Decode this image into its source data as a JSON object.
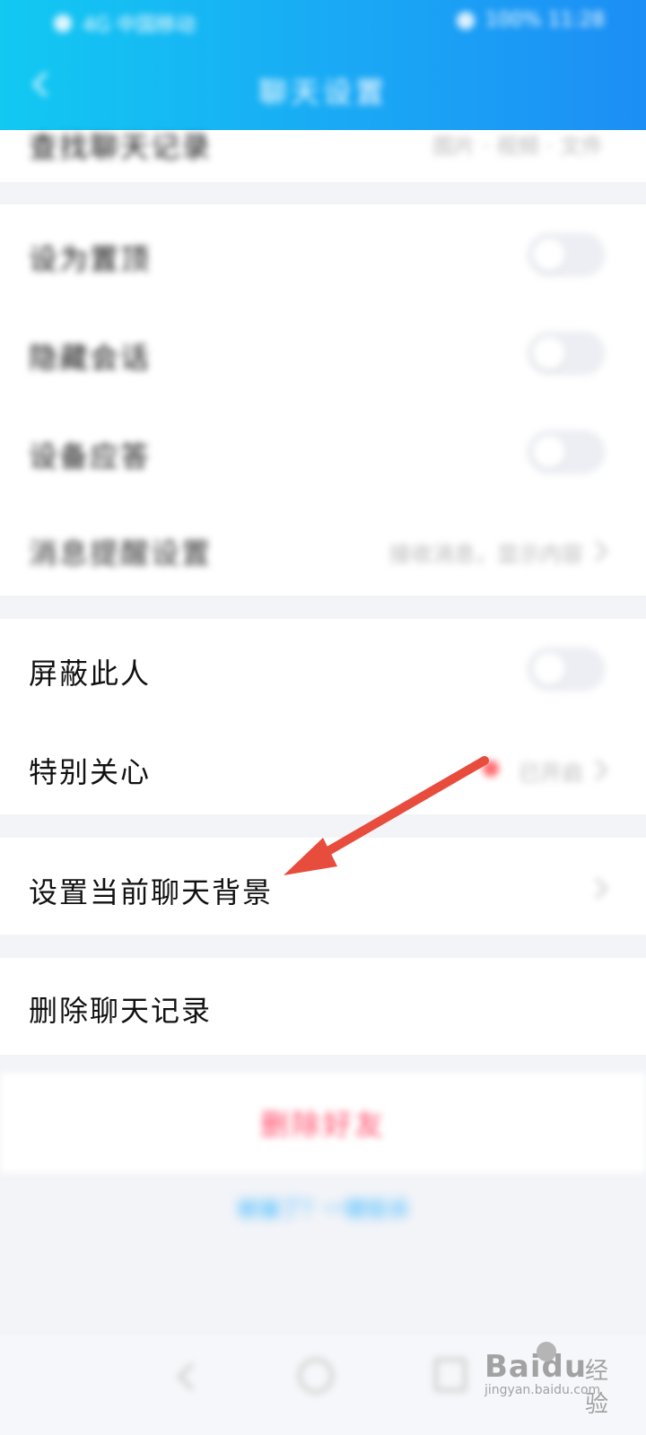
{
  "header": {
    "title": "聊天设置",
    "status_left": "4G 中国移动",
    "status_right": "100% 11:28"
  },
  "top_row": {
    "label": "查找聊天记录",
    "value": "图片 · 视频 · 文件"
  },
  "settings_group_1": [
    {
      "label": "设为置顶",
      "type": "toggle"
    },
    {
      "label": "隐藏会话",
      "type": "toggle"
    },
    {
      "label": "设备应答",
      "type": "toggle"
    },
    {
      "label": "消息提醒设置",
      "type": "value",
      "value": "接收消息，显示内容"
    }
  ],
  "settings_group_2": [
    {
      "label": "屏蔽此人",
      "type": "toggle"
    },
    {
      "label": "特别关心",
      "type": "value",
      "value": "已开启"
    }
  ],
  "chat_background": {
    "label": "设置当前聊天背景"
  },
  "delete_history": {
    "label": "删除聊天记录"
  },
  "delete_friend": {
    "label": "删除好友"
  },
  "report_link": {
    "label": "被骗了？一键投诉"
  },
  "watermark": {
    "brand": "Baidu",
    "suffix": "经验",
    "url": "jingyan.baidu.com"
  },
  "colors": {
    "accent_start": "#12c9f2",
    "accent_end": "#1c8ef5",
    "annotation_arrow": "#e74c3c",
    "danger": "#ff4b6b",
    "link": "#33b5ff"
  },
  "icons": [
    "back-icon",
    "chevron-right-icon",
    "toggle-switch",
    "nav-back-icon",
    "nav-home-icon",
    "nav-recent-icon"
  ]
}
